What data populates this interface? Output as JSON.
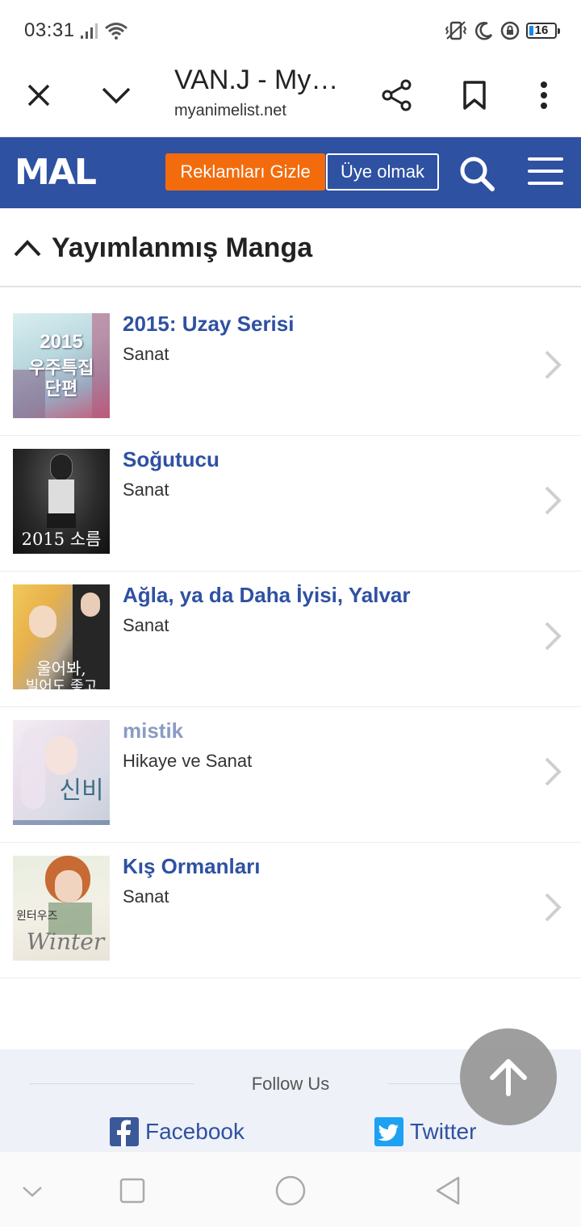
{
  "status_bar": {
    "time": "03:31",
    "battery": "16",
    "icons": [
      "signal-icon",
      "wifi-icon",
      "vibrate-icon",
      "moon-icon",
      "lock-rotation-icon",
      "battery-icon"
    ]
  },
  "browser": {
    "title": "VAN.J - My…",
    "url": "myanimelist.net",
    "icons": [
      "close-icon",
      "chevron-down-icon",
      "share-icon",
      "bookmark-icon",
      "more-vert-icon"
    ]
  },
  "mal_header": {
    "logo": "MAL",
    "hide_ads_label": "Reklamları Gizle",
    "join_label": "Üye olmak",
    "accent_color": "#2e51a2",
    "ads_color": "#f26c0d"
  },
  "section": {
    "title": "Yayımlanmış Manga"
  },
  "manga": [
    {
      "title": "2015: Uzay Serisi",
      "role": "Sanat",
      "cover_text": [
        "2015",
        "우주특집",
        "단편"
      ]
    },
    {
      "title": "Soğutucu",
      "role": "Sanat",
      "cover_text": [
        "2015 소름"
      ]
    },
    {
      "title": "Ağla, ya da Daha İyisi, Yalvar",
      "role": "Sanat",
      "cover_text": [
        "울어봐,",
        "빌어도 좋고"
      ]
    },
    {
      "title": "mistik",
      "role": "Hikaye ve Sanat",
      "cover_text": [
        "신비"
      ]
    },
    {
      "title": "Kış Ormanları",
      "role": "Sanat",
      "cover_text": [
        "윈터우즈",
        "Winter"
      ]
    }
  ],
  "footer": {
    "follow_label": "Follow Us",
    "facebook_label": "Facebook",
    "twitter_label": "Twitter"
  }
}
